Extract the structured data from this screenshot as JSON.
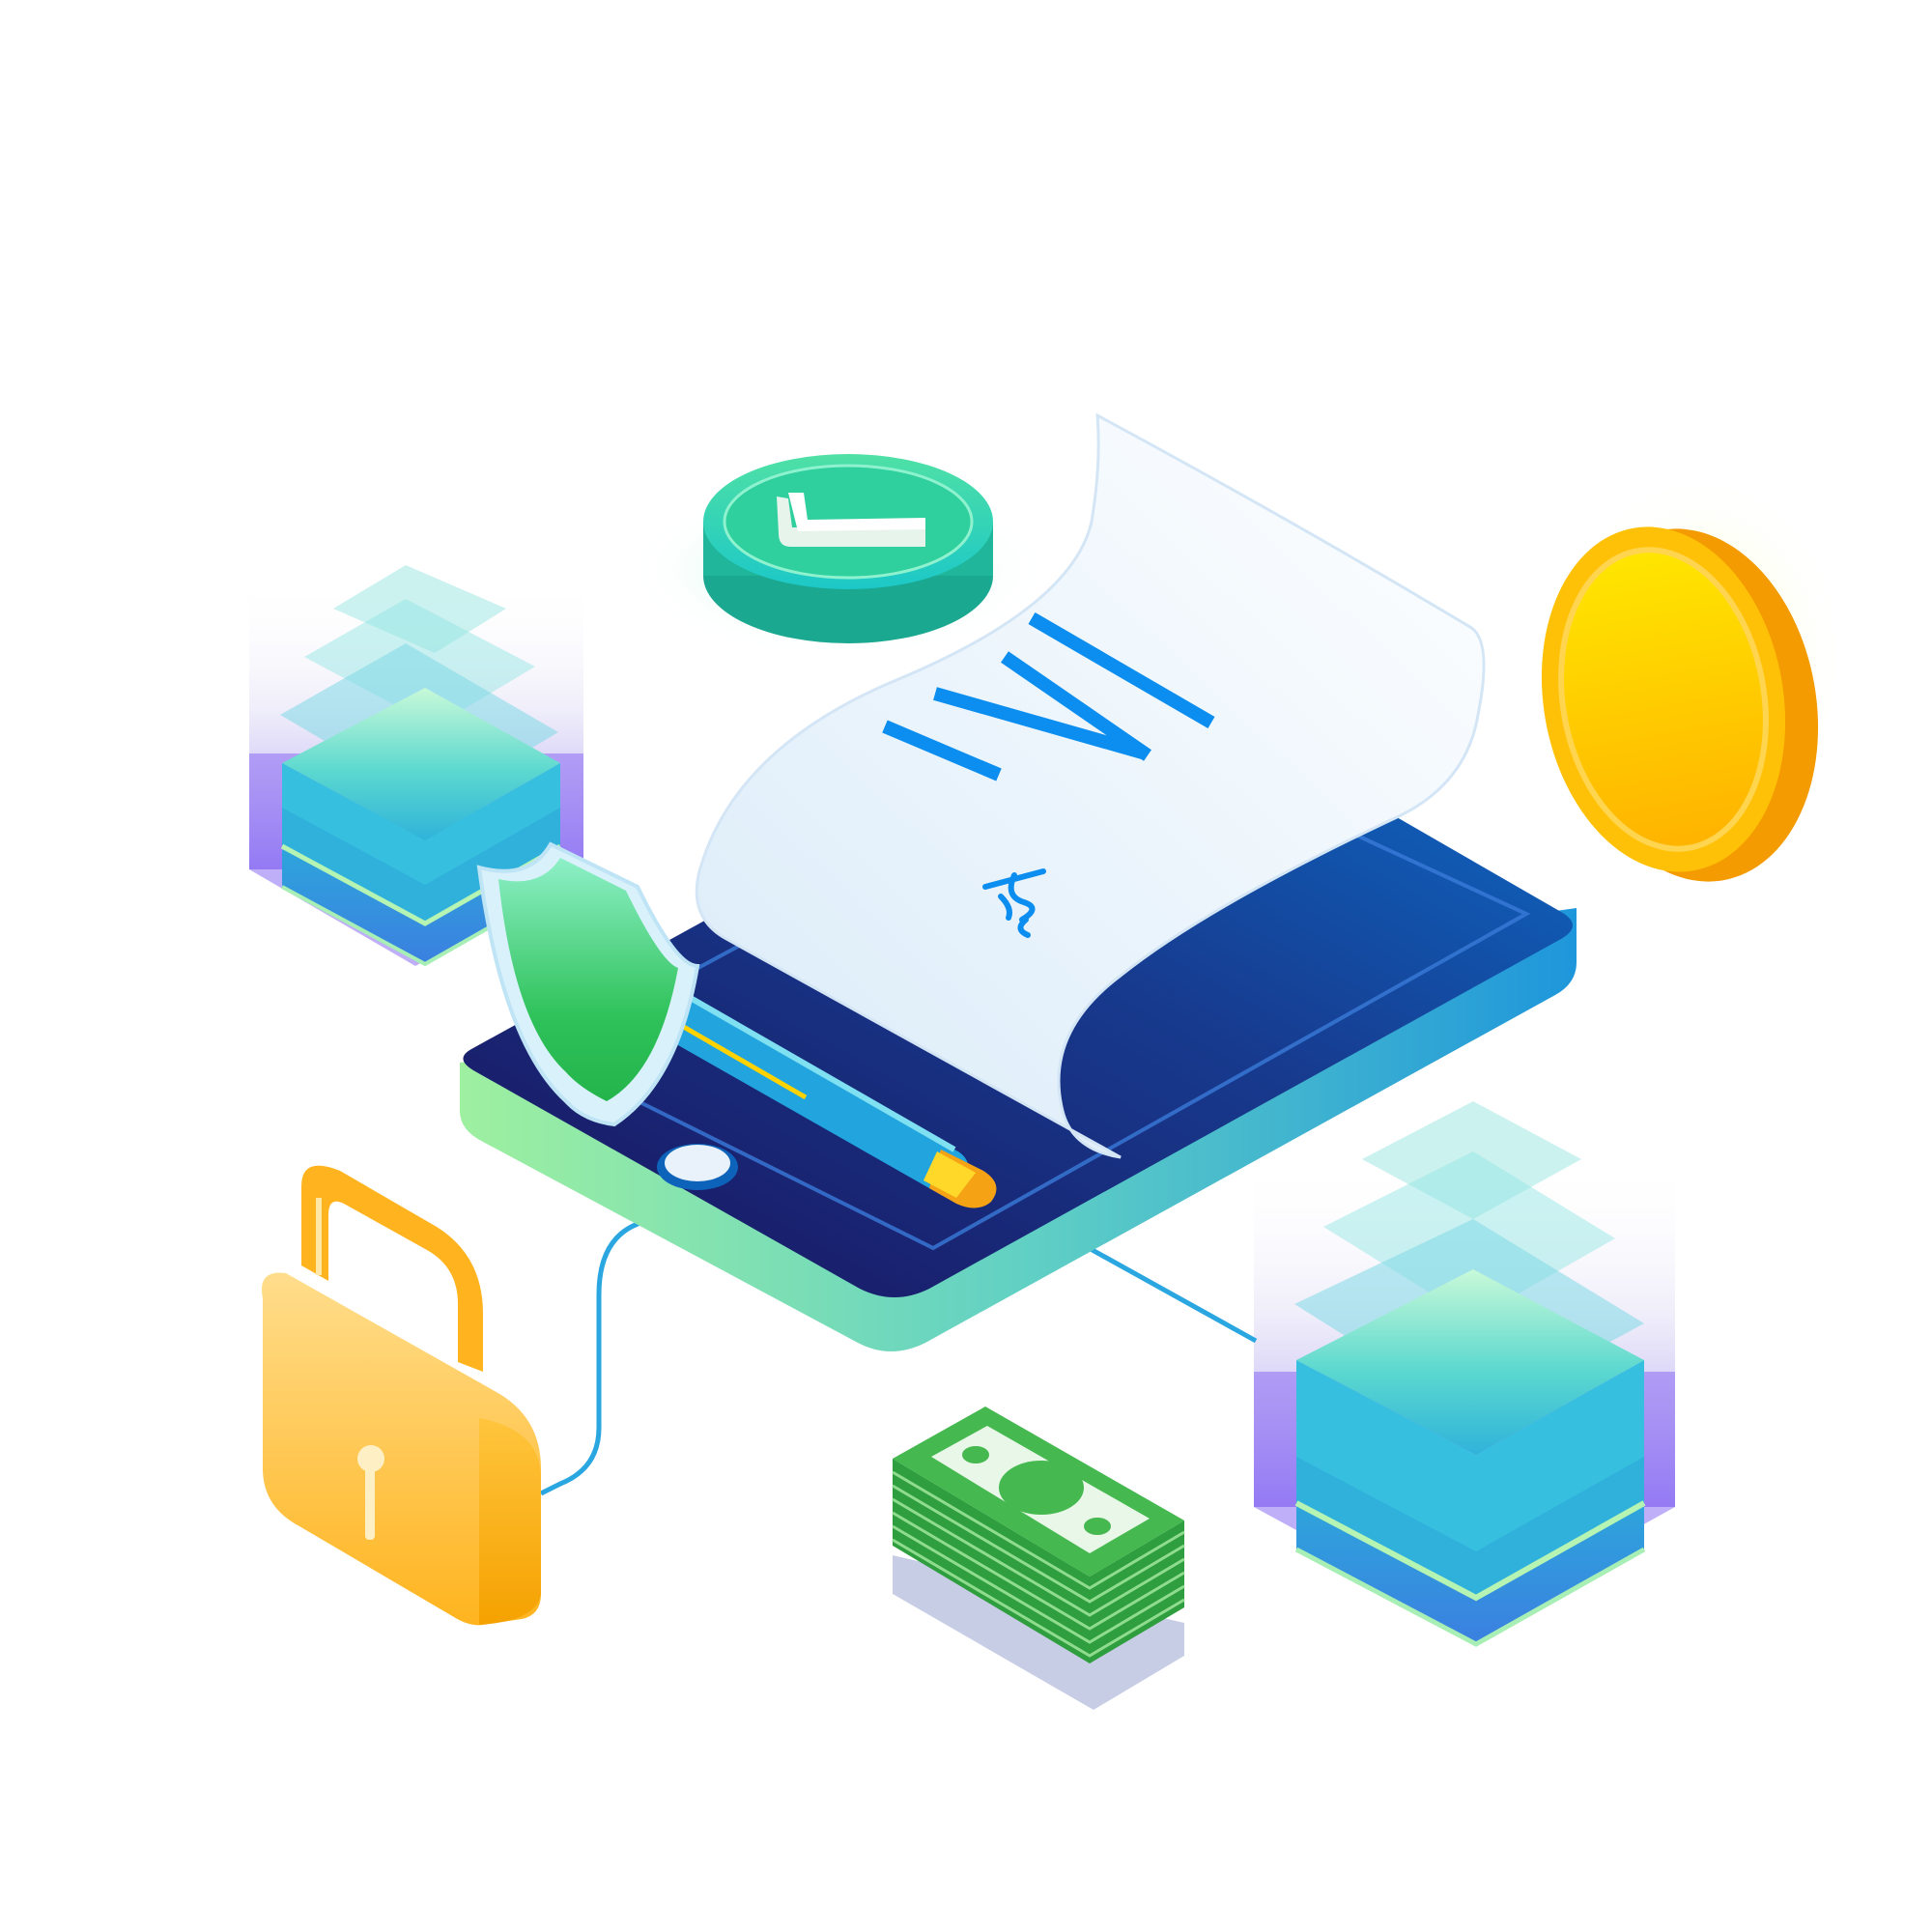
{
  "scene": {
    "text": "",
    "colors": {
      "background": "#ffffff",
      "tablet_screen": "#14307f",
      "tablet_side": "#29a7dd",
      "tablet_base": "#9cefa2",
      "document": "#eef6fd",
      "document_lines": "#0b8ef0",
      "check_badge": "#24d4a4",
      "coin": "#ffc107",
      "lock": "#ffb72a",
      "cash": "#3fbe4f",
      "server": "#3ec7dc",
      "shield": "#2fc36b",
      "pen": "#26a9e0"
    },
    "icons": [
      "tablet-icon",
      "document-icon",
      "signature-icon",
      "check-badge-icon",
      "gold-coin-icon",
      "shield-icon",
      "pen-icon",
      "padlock-icon",
      "cash-stack-icon",
      "server-stack-icon"
    ]
  }
}
